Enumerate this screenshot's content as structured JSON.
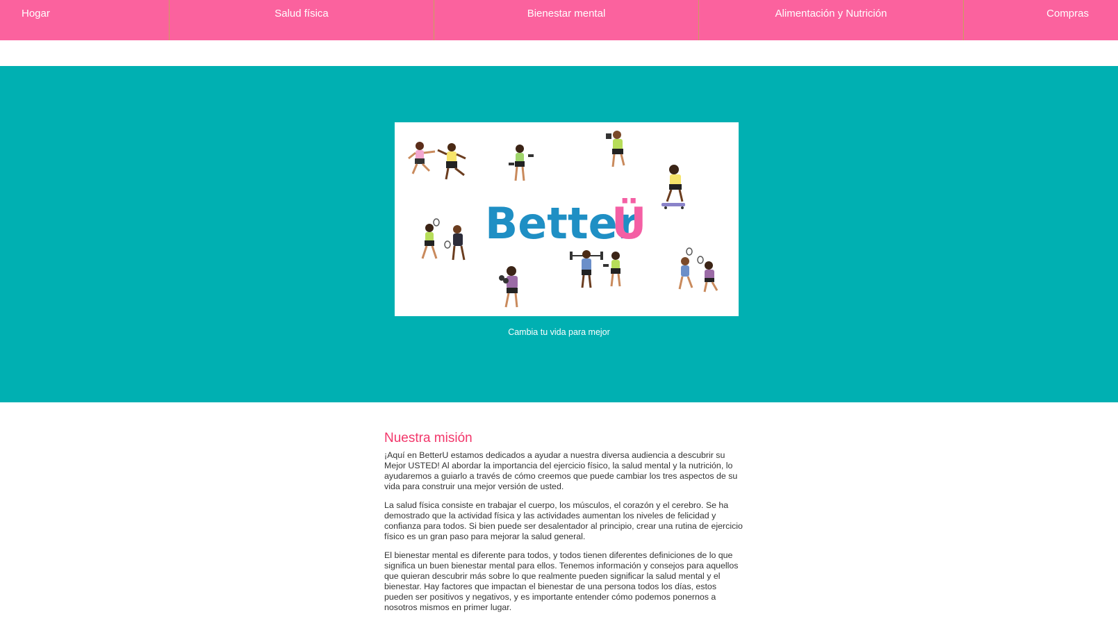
{
  "nav": {
    "items": [
      "Hogar",
      "Salud física",
      "Bienestar mental",
      "Alimentación y Nutrición",
      "Compras"
    ]
  },
  "banner": {
    "logo_text": "Better",
    "logo_u": "Ü",
    "tagline": "Cambia tu vida para mejor"
  },
  "mission": {
    "title": "Nuestra misión",
    "paragraphs": [
      "¡Aquí en BetterU estamos dedicados a ayudar a nuestra diversa audiencia a descubrir su Mejor USTED! Al abordar la importancia del ejercicio físico, la salud mental y la nutrición, lo ayudaremos a guiarlo a través de cómo creemos que puede cambiar los tres aspectos de su vida para construir una mejor versión de usted.",
      "La salud física consiste en trabajar el cuerpo, los músculos, el corazón y el cerebro. Se ha demostrado que la actividad física y las actividades aumentan los niveles de felicidad y confianza para todos. Si bien puede ser desalentador al principio, crear una rutina de ejercicio físico es un gran paso para mejorar la salud general.",
      "El bienestar mental es diferente para todos, y todos tienen diferentes definiciones de lo que significa un buen bienestar mental para ellos. Tenemos información y consejos para aquellos que quieran descubrir más sobre lo que realmente pueden significar la salud mental y el bienestar. Hay factores que impactan el bienestar de una persona todos los días, estos pueden ser positivos y negativos, y es importante entender cómo podemos ponernos a nosotros mismos en primer lugar."
    ]
  },
  "colors": {
    "nav_bg": "#fb629e",
    "hero_bg": "#00b0b2",
    "logo_blue": "#1f8fc4",
    "logo_pink": "#f45fa4",
    "mission_title": "#f2366a"
  }
}
